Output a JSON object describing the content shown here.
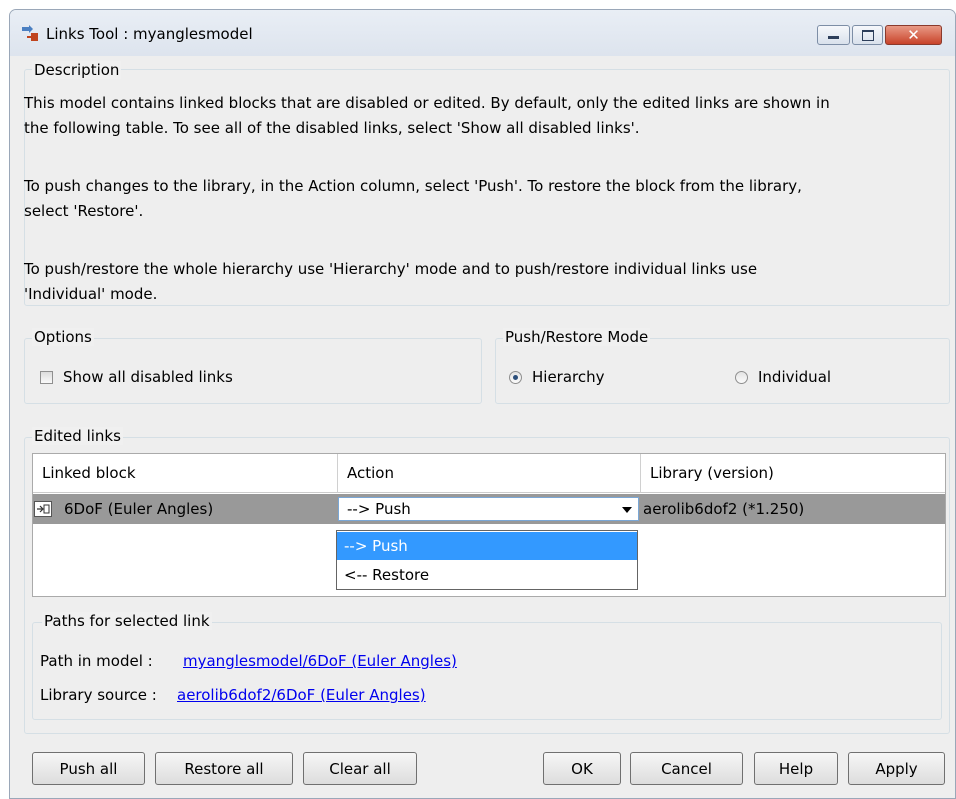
{
  "window": {
    "title": "Links Tool : myanglesmodel"
  },
  "description": {
    "legend": "Description",
    "paragraphs": [
      "This model contains linked blocks that are disabled or edited. By default, only the edited links are shown in",
      "the following table. To see all of the disabled links, select 'Show all disabled links'.",
      "To push changes to the library, in the Action column, select 'Push'. To restore the block from the library,",
      "select 'Restore'.",
      "To push/restore the whole hierarchy use 'Hierarchy' mode and to push/restore individual links use",
      "'Individual' mode."
    ]
  },
  "options": {
    "legend": "Options",
    "show_all_label": "Show all disabled links",
    "show_all_checked": false
  },
  "mode": {
    "legend": "Push/Restore Mode",
    "options": [
      "Hierarchy",
      "Individual"
    ],
    "selected": "Hierarchy"
  },
  "edited_links": {
    "legend": "Edited links",
    "columns": [
      "Linked block",
      "Action",
      "Library (version)"
    ],
    "rows": [
      {
        "block": "6DoF (Euler Angles)",
        "action": "--> Push",
        "library": "aerolib6dof2 (*1.250)",
        "icon": "block-link-icon"
      }
    ],
    "dropdown_options": [
      "--> Push",
      "<-- Restore"
    ],
    "dropdown_selected": "--> Push"
  },
  "paths": {
    "legend": "Paths for selected link",
    "model_label": "Path in model  :",
    "model_link": "myanglesmodel/6DoF (Euler Angles)",
    "library_label": "Library source :",
    "library_link": "aerolib6dof2/6DoF (Euler Angles)"
  },
  "buttons": {
    "push_all": "Push all",
    "restore_all": "Restore all",
    "clear_all": "Clear all",
    "ok": "OK",
    "cancel": "Cancel",
    "help": "Help",
    "apply": "Apply"
  },
  "icons": {
    "app": "links-tool-icon",
    "minimize": "minimize-icon",
    "maximize": "maximize-icon",
    "close": "close-icon",
    "dropdown": "chevron-down-icon"
  }
}
